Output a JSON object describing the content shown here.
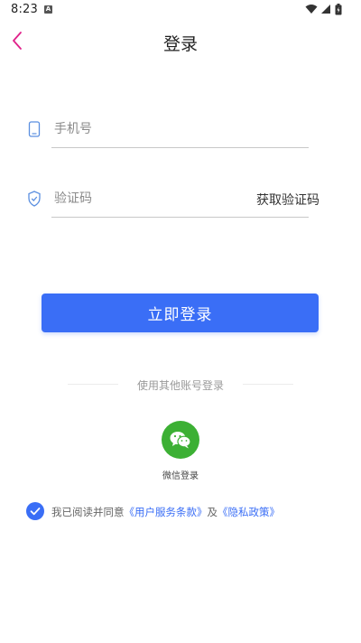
{
  "status_bar": {
    "time": "8:23",
    "notification_badge": "A",
    "icons": [
      "wifi-icon",
      "signal-icon",
      "battery-icon"
    ]
  },
  "nav": {
    "title": "登录",
    "back_icon": "chevron-left-icon",
    "accent_color": "#e0218a"
  },
  "form": {
    "phone": {
      "placeholder": "手机号",
      "value": "",
      "icon": "phone-icon"
    },
    "code": {
      "placeholder": "验证码",
      "value": "",
      "icon": "shield-icon",
      "get_code_label": "获取验证码"
    }
  },
  "login_button": {
    "label": "立即登录",
    "color": "#3a6ef6"
  },
  "other_login": {
    "divider_text": "使用其他账号登录",
    "wechat_label": "微信登录",
    "wechat_icon": "wechat-icon",
    "wechat_color": "#3cb034"
  },
  "agreement": {
    "checked": true,
    "prefix": "我已阅读并同意",
    "terms_link": "《用户服务条款》",
    "conjunction": "及",
    "privacy_link": "《隐私政策》"
  }
}
